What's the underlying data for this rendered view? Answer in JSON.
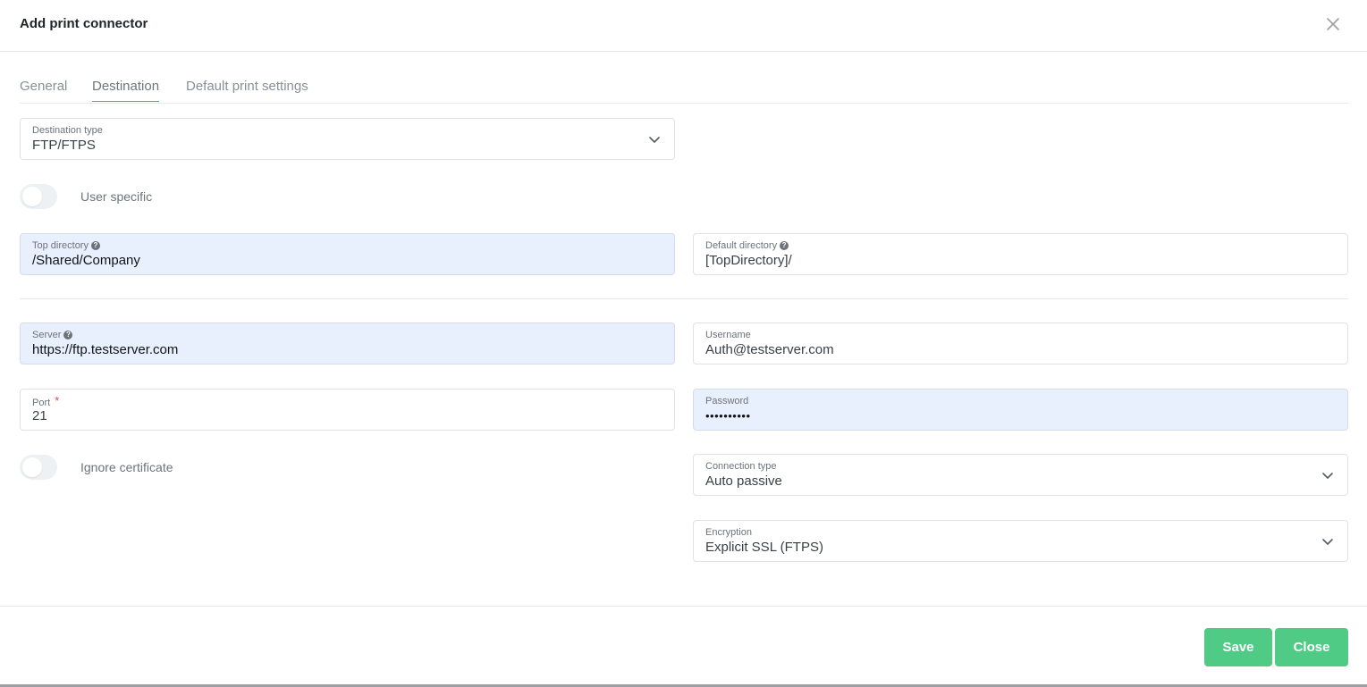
{
  "dialog": {
    "title": "Add print connector",
    "close_icon": "close-icon"
  },
  "tabs": [
    {
      "label": "General",
      "active": false
    },
    {
      "label": "Destination",
      "active": true
    },
    {
      "label": "Default print settings",
      "active": false
    }
  ],
  "form": {
    "destination_type": {
      "label": "Destination type",
      "value": "FTP/FTPS"
    },
    "user_specific": {
      "label": "User specific",
      "checked": false
    },
    "top_directory": {
      "label": "Top directory",
      "value": "/Shared/Company"
    },
    "default_directory": {
      "label": "Default directory",
      "value": "[TopDirectory]/"
    },
    "server": {
      "label": "Server",
      "value": "https://ftp.testserver.com"
    },
    "username": {
      "label": "Username",
      "value": "Auth@testserver.com"
    },
    "port": {
      "label": "Port",
      "required_mark": "*",
      "value": "21"
    },
    "password": {
      "label": "Password",
      "value": "••••••••••"
    },
    "ignore_certificate": {
      "label": "Ignore certificate",
      "checked": false
    },
    "connection_type": {
      "label": "Connection type",
      "value": "Auto passive"
    },
    "encryption": {
      "label": "Encryption",
      "value": "Explicit SSL (FTPS)"
    }
  },
  "footer": {
    "save_label": "Save",
    "close_label": "Close"
  },
  "colors": {
    "accent": "#4fcb86",
    "tab_underline": "#3cb878",
    "autofill_bg": "#e8f0fe",
    "required": "#e5484d"
  },
  "help_icon": "?"
}
